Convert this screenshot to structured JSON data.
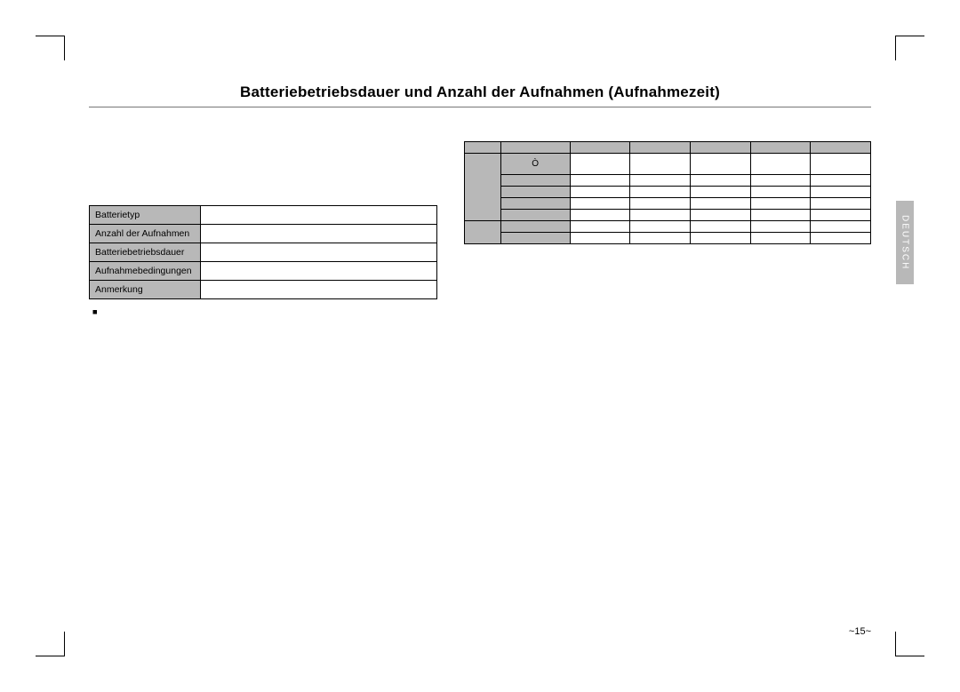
{
  "title": "Batteriebetriebsdauer und Anzahl der Aufnahmen (Aufnahmezeit)",
  "lang_tab": "DEUTSCH",
  "page_number": "~15~",
  "left": {
    "intro": "",
    "t1_rows": [
      {
        "label": "Batterietyp",
        "value": ""
      },
      {
        "label": "Anzahl der Aufnahmen",
        "value": ""
      },
      {
        "label": "Batteriebetriebsdauer",
        "value": ""
      },
      {
        "label": "Aufnahmebedingungen",
        "value": ""
      },
      {
        "label": "Anmerkung",
        "value": ""
      }
    ],
    "bullets": [
      "",
      "",
      ""
    ]
  },
  "right": {
    "heading": "",
    "caption": "",
    "t2_header": [
      "",
      "",
      "",
      "",
      "",
      "",
      ""
    ],
    "t2": [
      {
        "stub1": "",
        "stub2": "Ò",
        "c": [
          "",
          "",
          "",
          "",
          ""
        ]
      },
      {
        "stub1": null,
        "stub2": "",
        "c": [
          "",
          "",
          "",
          "",
          ""
        ]
      },
      {
        "stub1": null,
        "stub2": "",
        "c": [
          "",
          "",
          "",
          "",
          ""
        ]
      },
      {
        "stub1": null,
        "stub2": "",
        "c": [
          "",
          "",
          "",
          "",
          ""
        ]
      },
      {
        "stub1": null,
        "stub2": "",
        "c": [
          "",
          "",
          "",
          "",
          ""
        ]
      },
      {
        "stub1": "",
        "stub2": "",
        "c": [
          "",
          "",
          "",
          "",
          ""
        ]
      },
      {
        "stub1": null,
        "stub2": "",
        "c": [
          "",
          "",
          "",
          "",
          ""
        ]
      }
    ]
  }
}
